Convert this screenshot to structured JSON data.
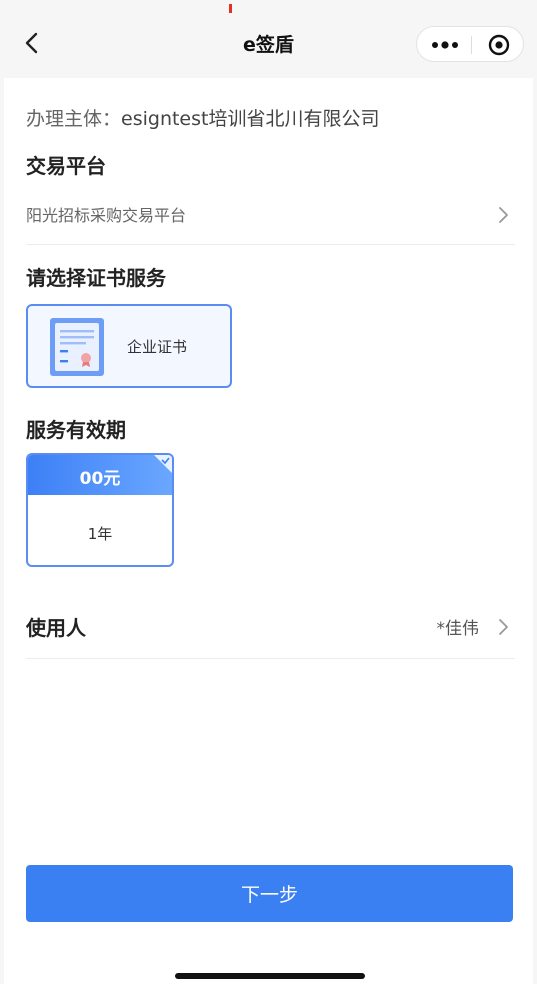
{
  "nav": {
    "title": "e签盾",
    "back_icon": "chevron-left-icon",
    "more_icon": "more-dots-icon",
    "close_icon": "target-circle-icon"
  },
  "subject": {
    "label": "办理主体：",
    "value": "esigntest培训省北川有限公司"
  },
  "platform": {
    "title": "交易平台",
    "selected": "阳光招标采购交易平台"
  },
  "certificate": {
    "title": "请选择证书服务",
    "option_label": "企业证书",
    "option_icon": "certificate-document-icon"
  },
  "validity": {
    "title": "服务有效期",
    "price": "00元",
    "duration": "1年"
  },
  "user": {
    "label": "使用人",
    "value": "*佳伟"
  },
  "actions": {
    "next_label": "下一步"
  },
  "colors": {
    "accent": "#3b80f3",
    "card_border": "#5b8cf2"
  }
}
